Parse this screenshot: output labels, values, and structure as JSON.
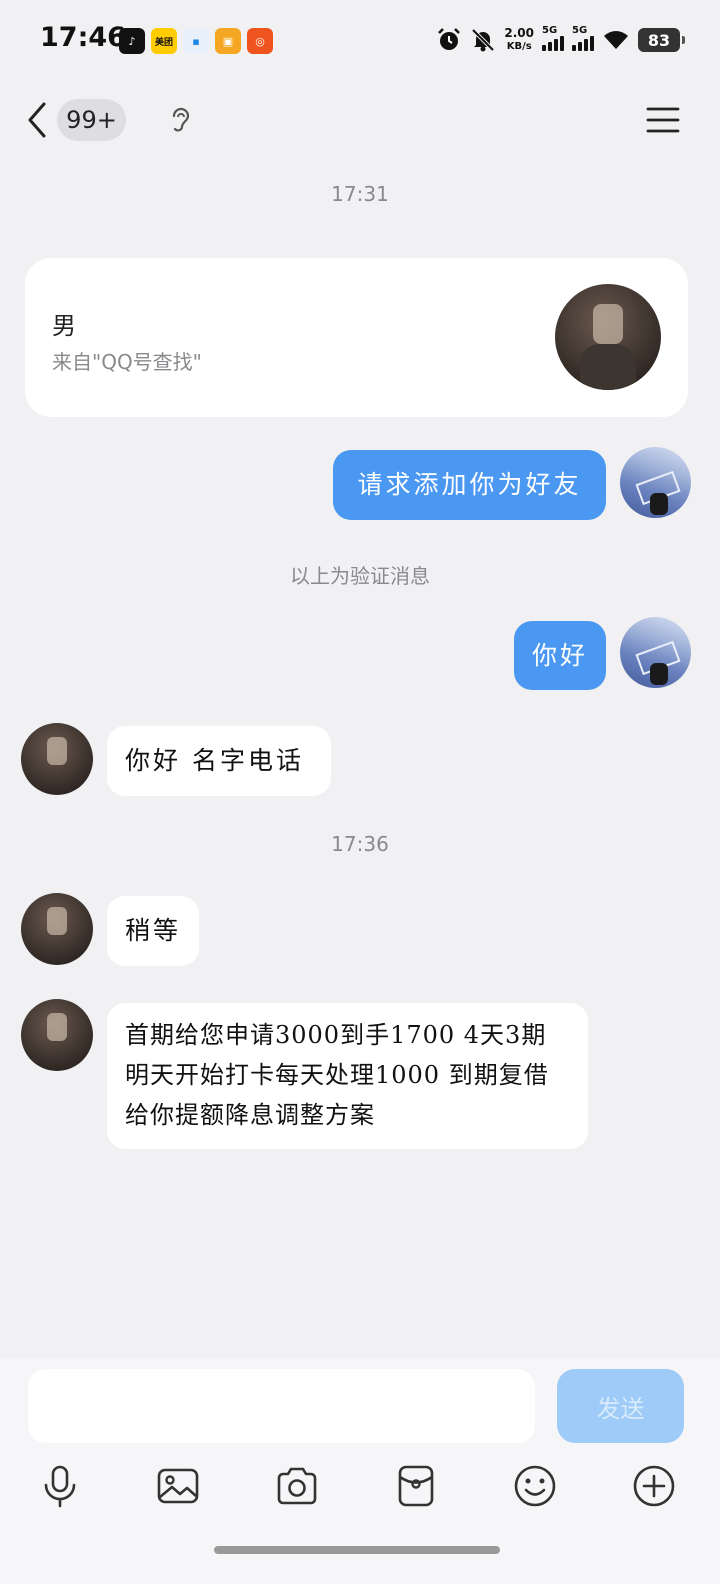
{
  "status_bar": {
    "time": "17:46",
    "apps": [
      {
        "name": "douyin-app-icon",
        "glyph": "♪",
        "color": "#111111"
      },
      {
        "name": "meituan-app-icon",
        "glyph": "美团",
        "color": "#ffcc00"
      },
      {
        "name": "app-icon-blue",
        "glyph": "▪",
        "color": "#1e88e5"
      },
      {
        "name": "app-icon-orange",
        "glyph": "▣",
        "color": "#f5a623"
      },
      {
        "name": "app-icon-red",
        "glyph": "◎",
        "color": "#f0541e"
      }
    ],
    "net_speed_value": "2.00",
    "net_speed_unit": "KB/s",
    "signal1_label": "5G",
    "signal2_label": "5G",
    "battery": "83"
  },
  "header": {
    "unread_badge": "99+"
  },
  "conversation": {
    "time1": "17:31",
    "profile": {
      "gender": "男",
      "source": "来自\"QQ号查找\""
    },
    "msg_request": "请求添加你为好友",
    "verify_note": "以上为验证消息",
    "msg_hello_self": "你好",
    "msg_hello_other": "你好 名字电话",
    "time2": "17:36",
    "msg_wait": "稍等",
    "msg_offer": "首期给您申请3000到手1700 4天3期 明天开始打卡每天处理1000 到期复借给你提额降息调整方案"
  },
  "composer": {
    "input_value": "",
    "send_label": "发送"
  },
  "toolbar": {
    "icons": [
      "microphone-icon",
      "image-icon",
      "camera-icon",
      "red-packet-icon",
      "emoji-icon",
      "plus-icon"
    ]
  },
  "colors": {
    "self_bubble": "#4b98f2",
    "send_button": "#9ecbf7",
    "background": "#f1f1f3"
  }
}
